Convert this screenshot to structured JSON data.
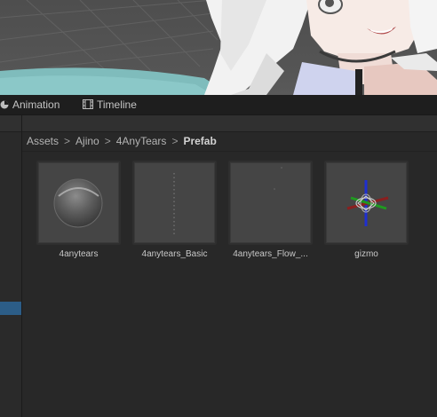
{
  "tabs": {
    "animation": {
      "label": "Animation",
      "icon": "animation-icon"
    },
    "timeline": {
      "label": "Timeline",
      "icon": "film-icon"
    }
  },
  "breadcrumb": {
    "items": [
      "Assets",
      "Ajino",
      "4AnyTears"
    ],
    "current": "Prefab",
    "separator": ">"
  },
  "assets": [
    {
      "label": "4anytears",
      "preview": "glass-sphere"
    },
    {
      "label": "4anytears_Basic",
      "preview": "dotted-line"
    },
    {
      "label": "4anytears_Flow_...",
      "preview": "dot"
    },
    {
      "label": "gizmo",
      "preview": "axis-gizmo"
    }
  ],
  "colors": {
    "selection": "#2c5d87",
    "panel_bg": "#282828",
    "tile_bg": "#454545"
  }
}
